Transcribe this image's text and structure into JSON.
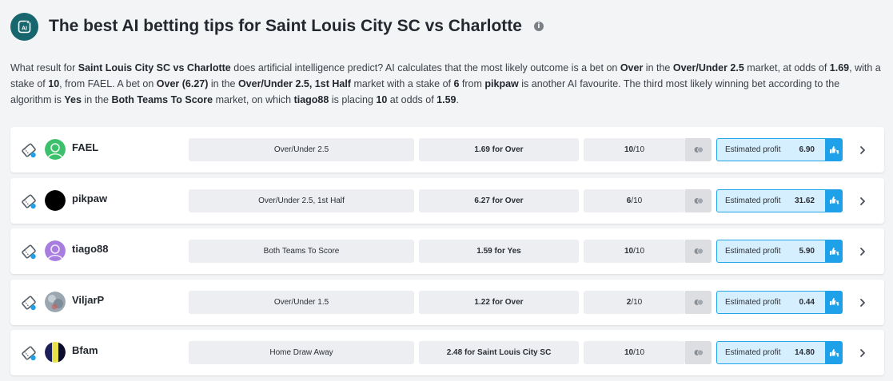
{
  "header": {
    "title": "The best AI betting tips for Saint Louis City SC vs Charlotte",
    "ai_badge_text": "AI",
    "info_icon": "info-icon"
  },
  "intro": {
    "s1": "What result for ",
    "b1": "Saint Louis City SC vs Charlotte",
    "s2": " does artificial intelligence predict? AI calculates that the most likely outcome is a bet on ",
    "b2": "Over",
    "s3": " in the ",
    "b3": "Over/Under 2.5",
    "s4": " market, at odds of ",
    "b4": "1.69",
    "s5": ", with a stake of ",
    "b5": "10",
    "s6": ", from FAEL. A bet on ",
    "b6": "Over",
    "s7": " ",
    "b7": "(6.27)",
    "s8": " in the ",
    "b8": "Over/Under 2.5, 1st Half",
    "s9": " market with a stake of ",
    "b9": "6",
    "s10": " from ",
    "b10": "pikpaw",
    "s11": " is another AI favourite. The third most likely winning bet according to the algorithm is ",
    "b11": "Yes",
    "s12": " in the ",
    "b12": "Both Teams To Score",
    "s13": " market, on which ",
    "b13": "tiago88",
    "s14": " is placing ",
    "b14": "10",
    "s15": " at odds of ",
    "b15": "1.59",
    "s16": "."
  },
  "colors": {
    "accent": "#1ea1e8",
    "profit_bg": "#d6efff",
    "badge": "#17666e"
  },
  "tips": [
    {
      "username": "FAEL",
      "market": "Over/Under 2.5",
      "odds": "1.69 for Over",
      "stake": "10",
      "stake_max": "/10",
      "profit_label": "Estimated profit",
      "profit": "6.90"
    },
    {
      "username": "pikpaw",
      "market": "Over/Under 2.5, 1st Half",
      "odds": "6.27 for Over",
      "stake": "6",
      "stake_max": "/10",
      "profit_label": "Estimated profit",
      "profit": "31.62"
    },
    {
      "username": "tiago88",
      "market": "Both Teams To Score",
      "odds": "1.59 for Yes",
      "stake": "10",
      "stake_max": "/10",
      "profit_label": "Estimated profit",
      "profit": "5.90"
    },
    {
      "username": "ViljarP",
      "market": "Over/Under 1.5",
      "odds": "1.22 for Over",
      "stake": "2",
      "stake_max": "/10",
      "profit_label": "Estimated profit",
      "profit": "0.44"
    },
    {
      "username": "Bfam",
      "market": "Home Draw Away",
      "odds": "2.48 for Saint Louis City SC",
      "stake": "10",
      "stake_max": "/10",
      "profit_label": "Estimated profit",
      "profit": "14.80"
    }
  ]
}
